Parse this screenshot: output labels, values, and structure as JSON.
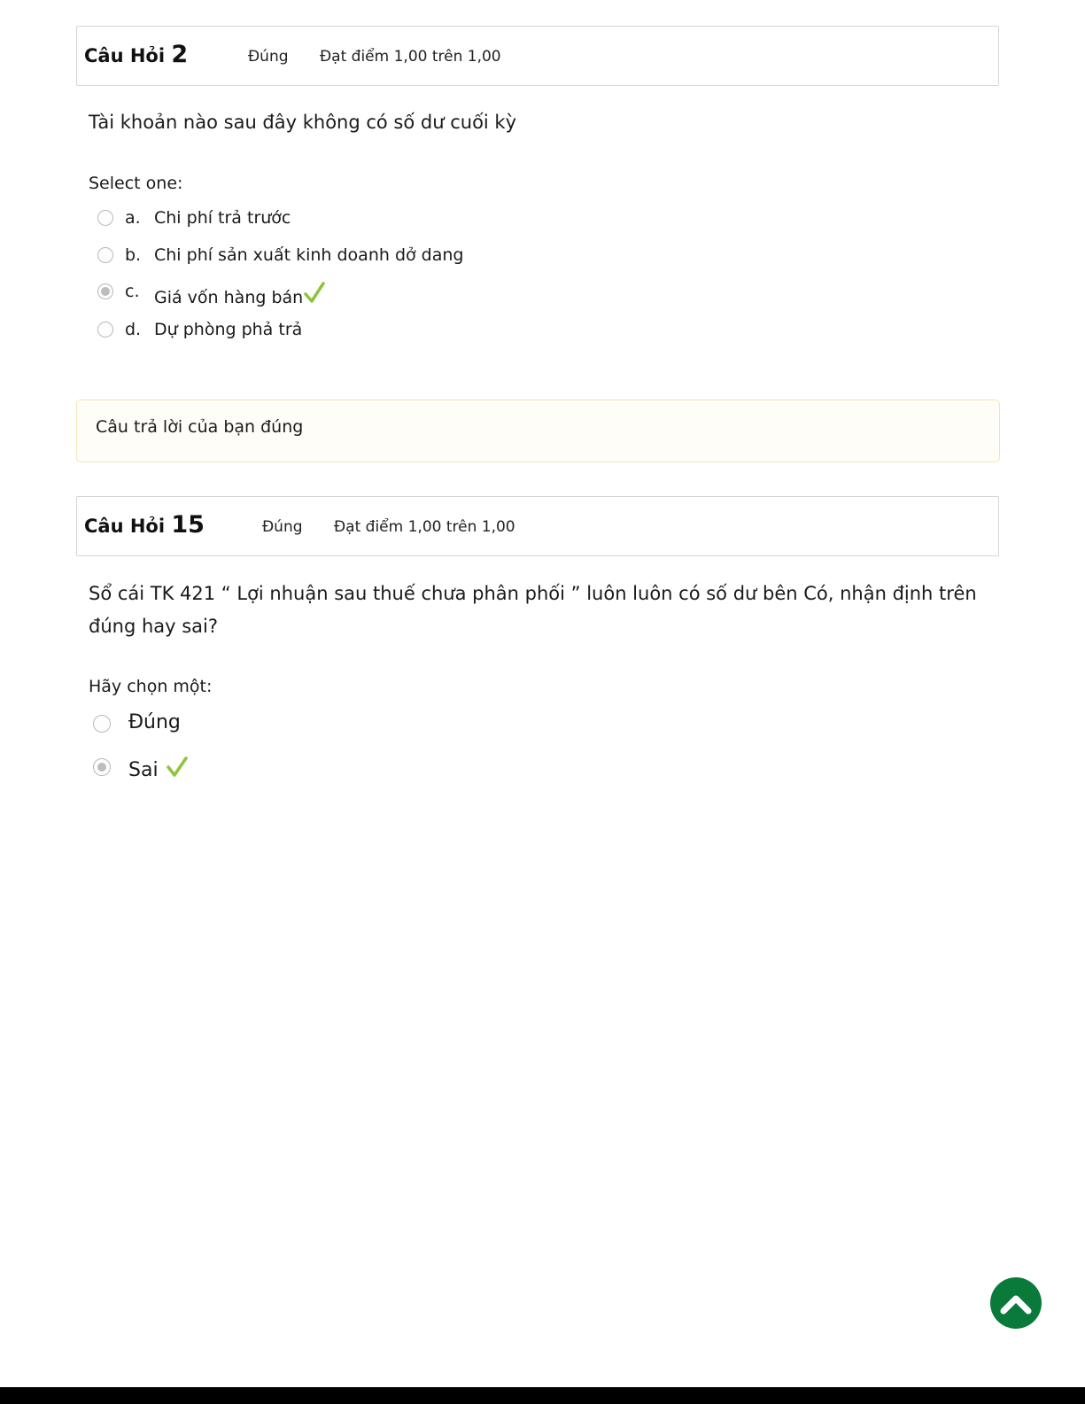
{
  "question2": {
    "label": "Câu Hỏi",
    "number": "2",
    "state": "Đúng",
    "grade": "Đạt điểm 1,00 trên 1,00",
    "text": "Tài khoản nào sau đây không có số dư cuối kỳ",
    "prompt": "Select one:",
    "options": [
      {
        "letter": "a.",
        "text": "Chi phí trả trước",
        "selected": false,
        "correct": false
      },
      {
        "letter": "b.",
        "text": "Chi phí sản xuất kinh doanh dở dang",
        "selected": false,
        "correct": false
      },
      {
        "letter": "c.",
        "text": "Giá vốn hàng bán",
        "selected": true,
        "correct": true
      },
      {
        "letter": "d.",
        "text": "Dự phòng phả trả",
        "selected": false,
        "correct": false
      }
    ],
    "feedback": "Câu trả lời của bạn đúng"
  },
  "question15": {
    "label": "Câu Hỏi",
    "number": "15",
    "state": "Đúng",
    "grade": "Đạt điểm 1,00 trên 1,00",
    "text": "Sổ cái TK 421 “ Lợi nhuận sau thuế chưa phân phối ” luôn luôn có số dư bên Có, nhận định trên đúng hay sai?",
    "prompt": "Hãy chọn một:",
    "options": [
      {
        "text": "Đúng",
        "selected": false,
        "correct": false
      },
      {
        "text": "Sai",
        "selected": true,
        "correct": true
      }
    ]
  },
  "icons": {
    "check": "check-icon",
    "back_to_top": "chevron-up-icon"
  },
  "colors": {
    "check": "#8cc43c",
    "back_to_top": "#0a7a3b",
    "feedback_border": "#f4e6b5"
  }
}
